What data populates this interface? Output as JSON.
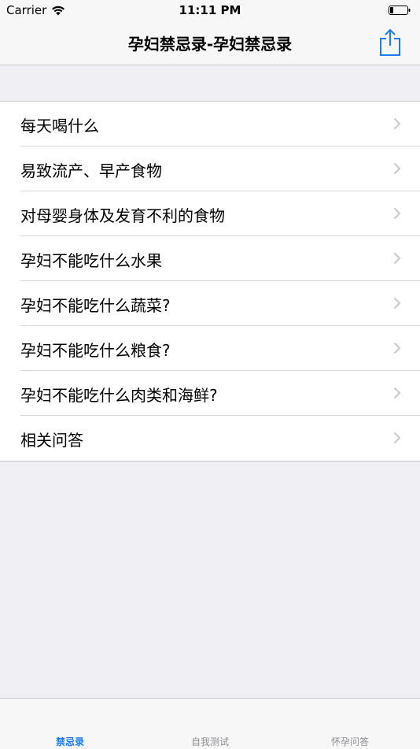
{
  "status_bar": {
    "carrier": "Carrier",
    "time": "11:11 PM",
    "wifi_icon": "wifi-icon",
    "battery_icon": "battery-icon"
  },
  "nav": {
    "title": "孕妇禁忌录-孕妇禁忌录",
    "share_icon": "share-icon"
  },
  "list": {
    "items": [
      {
        "label": "每天喝什么"
      },
      {
        "label": "易致流产、早产食物"
      },
      {
        "label": "对母婴身体及发育不利的食物"
      },
      {
        "label": "孕妇不能吃什么水果"
      },
      {
        "label": "孕妇不能吃什么蔬菜?"
      },
      {
        "label": "孕妇不能吃什么粮食?"
      },
      {
        "label": "孕妇不能吃什么肉类和海鲜?"
      },
      {
        "label": "相关问答"
      }
    ],
    "chevron_icon": "chevron-right-icon"
  },
  "tab_bar": {
    "tabs": [
      {
        "label": "禁忌录",
        "active": true
      },
      {
        "label": "自我测试",
        "active": false
      },
      {
        "label": "怀孕问答",
        "active": false
      }
    ]
  },
  "colors": {
    "accent": "#1a7cf6",
    "background": "#efeff4",
    "chevron": "#c7c7cc"
  }
}
